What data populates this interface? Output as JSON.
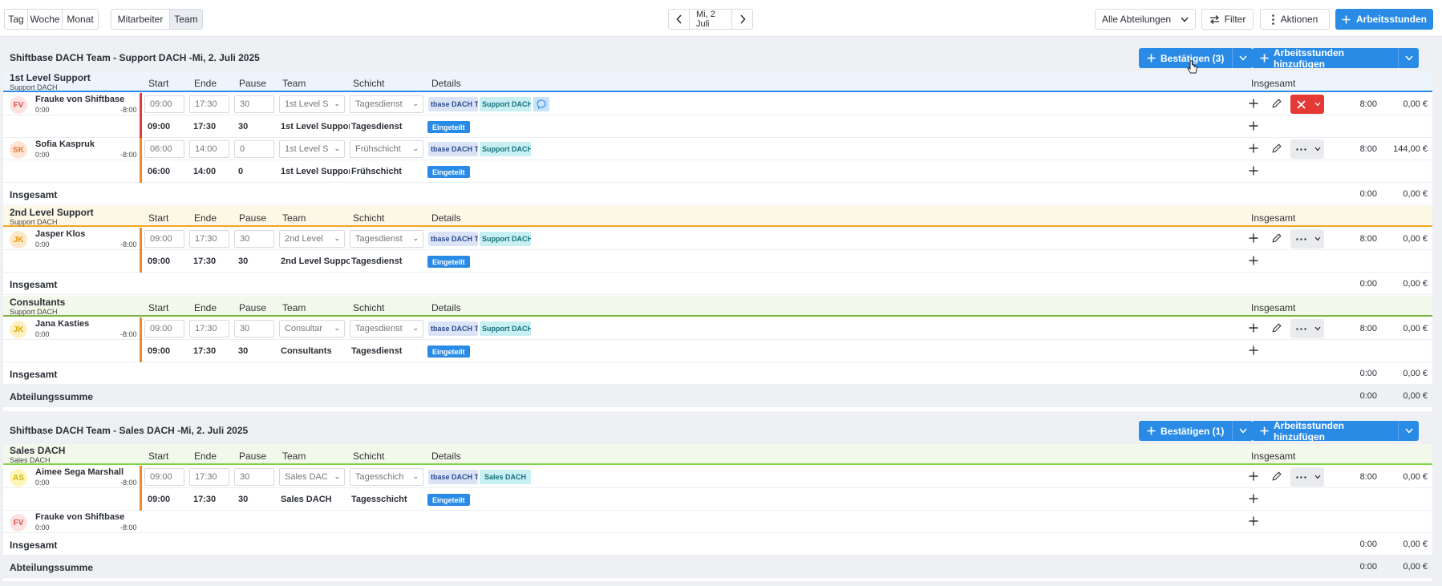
{
  "toolbar": {
    "views": [
      "Tag",
      "Woche",
      "Monat"
    ],
    "modes": [
      "Mitarbeiter",
      "Team"
    ],
    "date": "Mi, 2 Juli",
    "department_select": "Alle Abteilungen",
    "filter": "Filter",
    "actions": "Aktionen",
    "add_hours": "Arbeitsstunden"
  },
  "columns": {
    "start": "Start",
    "end": "Ende",
    "pause": "Pause",
    "team": "Team",
    "shift": "Schicht",
    "details": "Details",
    "total": "Insgesamt"
  },
  "labels": {
    "total": "Insgesamt",
    "dept_sum": "Abteilungssumme",
    "status": "Eingeteilt",
    "hours_button": "Arbeitsstunden hinzufügen"
  },
  "colors": {
    "primary": "#2a8be6",
    "danger": "#e53935"
  },
  "section1": {
    "title": "Shiftbase DACH Team - Support DACH -Mi, 2. Juli 2025",
    "confirm": "Bestätigen (3)",
    "groups": [
      {
        "name": "1st Level Support",
        "sub": "Support DACH",
        "color": "#2a8be6",
        "employees": [
          {
            "initials": "FV",
            "name": "Frauke von Shiftbase",
            "left": "0:00",
            "right": "-8:00",
            "start": "09:00",
            "end": "17:30",
            "pause": "30",
            "team": "1st Level S",
            "shift": "Tagesdienst",
            "tag1": "tbase DACH T",
            "tag2": "Support DACH",
            "r_start": "09:00",
            "r_end": "17:30",
            "r_pause": "30",
            "r_team": "1st Level Suppor",
            "r_shift": "Tagesdienst",
            "hours": "8:00",
            "money": "0,00 €"
          },
          {
            "initials": "SK",
            "name": "Sofia Kaspruk",
            "left": "0:00",
            "right": "-8:00",
            "start": "06:00",
            "end": "14:00",
            "pause": "0",
            "team": "1st Level S",
            "shift": "Frühschicht",
            "tag1": "tbase DACH T",
            "tag2": "Support DACH",
            "r_start": "06:00",
            "r_end": "14:00",
            "r_pause": "0",
            "r_team": "1st Level Suppor",
            "r_shift": "Frühschicht",
            "hours": "8:00",
            "money": "144,00 €"
          }
        ],
        "total_hours": "0:00",
        "total_money": "0,00 €"
      },
      {
        "name": "2nd Level Support",
        "sub": "Support DACH",
        "color": "#f5a623",
        "employees": [
          {
            "initials": "JK",
            "name": "Jasper Klos",
            "left": "0:00",
            "right": "-8:00",
            "start": "09:00",
            "end": "17:30",
            "pause": "30",
            "team": "2nd Level",
            "shift": "Tagesdienst",
            "tag1": "tbase DACH T",
            "tag2": "Support DACH",
            "r_start": "09:00",
            "r_end": "17:30",
            "r_pause": "30",
            "r_team": "2nd Level Suppo",
            "r_shift": "Tagesdienst",
            "hours": "8:00",
            "money": "0,00 €"
          }
        ],
        "total_hours": "0:00",
        "total_money": "0,00 €"
      },
      {
        "name": "Consultants",
        "sub": "Support DACH",
        "color": "#7cb342",
        "employees": [
          {
            "initials": "JK",
            "name": "Jana Kasties",
            "left": "0:00",
            "right": "-8:00",
            "start": "09:00",
            "end": "17:30",
            "pause": "30",
            "team": "Consultar",
            "shift": "Tagesdienst",
            "tag1": "tbase DACH T",
            "tag2": "Support DACH",
            "r_start": "09:00",
            "r_end": "17:30",
            "r_pause": "30",
            "r_team": "Consultants",
            "r_shift": "Tagesdienst",
            "hours": "8:00",
            "money": "0,00 €"
          }
        ],
        "total_hours": "0:00",
        "total_money": "0,00 €"
      }
    ],
    "dept_hours": "0:00",
    "dept_money": "0,00 €"
  },
  "section2": {
    "title": "Shiftbase DACH Team - Sales DACH -Mi, 2. Juli 2025",
    "confirm": "Bestätigen (1)",
    "group": {
      "name": "Sales DACH",
      "sub": "Sales DACH"
    },
    "employees": [
      {
        "initials": "AS",
        "name": "Aimee Sega Marshall",
        "left": "0:00",
        "right": "-8:00",
        "start": "09:00",
        "end": "17:30",
        "pause": "30",
        "team": "Sales DAC",
        "shift": "Tagesschich",
        "tag1": "tbase DACH T",
        "tag2": "Sales DACH",
        "r_start": "09:00",
        "r_end": "17:30",
        "r_pause": "30",
        "r_team": "Sales DACH",
        "r_shift": "Tagesschicht",
        "hours": "8:00",
        "money": "0,00 €"
      },
      {
        "initials": "FV",
        "name": "Frauke von Shiftbase",
        "left": "0:00",
        "right": "-8:00"
      }
    ],
    "total_hours": "0:00",
    "total_money": "0,00 €",
    "dept_hours": "0:00",
    "dept_money": "0,00 €"
  }
}
